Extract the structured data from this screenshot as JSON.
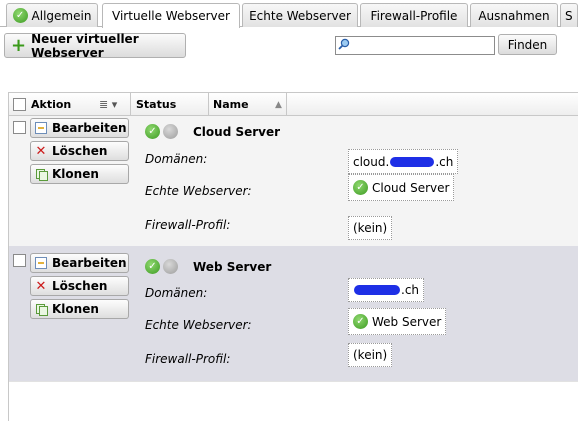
{
  "tabs": [
    {
      "label": "Allgemein",
      "icon": "check-icon"
    },
    {
      "label": "Virtuelle Webserver",
      "active": true
    },
    {
      "label": "Echte Webserver"
    },
    {
      "label": "Firewall-Profile"
    },
    {
      "label": "Ausnahmen"
    },
    {
      "label": "S"
    }
  ],
  "toolbar": {
    "new_label": "Neuer virtueller Webserver",
    "search_value": "",
    "find_label": "Finden"
  },
  "grid": {
    "headers": {
      "action": "Aktion",
      "status": "Status",
      "name": "Name"
    },
    "action_buttons": {
      "edit": "Bearbeiten",
      "delete": "Löschen",
      "clone": "Klonen"
    },
    "field_labels": {
      "domains": "Domänen:",
      "real_servers": "Echte Webserver:",
      "firewall": "Firewall-Profil:"
    },
    "rows": [
      {
        "name": "Cloud Server",
        "domain_prefix": "cloud.",
        "domain_suffix": ".ch",
        "real_server": "Cloud Server",
        "firewall": "(kein)"
      },
      {
        "name": "Web Server",
        "domain_prefix": "",
        "domain_suffix": ".ch",
        "real_server": "Web Server",
        "firewall": "(kein)"
      }
    ]
  },
  "colors": {
    "ok_green": "#3c9a22",
    "redaction_blue": "#1e2fe6",
    "row_alt": "#dddde5"
  }
}
